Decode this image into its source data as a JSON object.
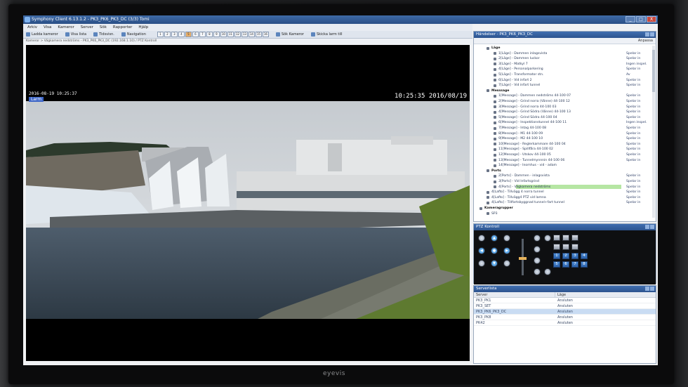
{
  "window": {
    "title": "Symphony Client 6.13.1.2 - PK3_PK6_PK3_DC (3/3) Tomi",
    "buttons": [
      "_",
      "□",
      "X"
    ]
  },
  "menu": [
    "Arkiv",
    "Visa",
    "Kameror",
    "Server",
    "Sök",
    "Rapporter",
    "Hjälp"
  ],
  "toolbar": {
    "items": [
      "Ladda kameror",
      "Visa lista",
      "Tidsvisn.",
      "Navigation",
      "Sök Kameror",
      "Skicka larm till"
    ],
    "layouts": [
      "1",
      "2",
      "3",
      "4",
      "5",
      "6",
      "7",
      "8",
      "9",
      "10",
      "11",
      "12",
      "13",
      "14",
      "15",
      "16"
    ]
  },
  "path": "Kameror > Vägkamera nedströms - PK3_PK6_PK3_DC (192.168.1.10) / PTZ Kontroll",
  "video": {
    "osd_date": "2016-08-19 10:25:37",
    "osd_badge": "Larm",
    "osd_time": "10:25:35 2016/08/19"
  },
  "events_panel": {
    "title": "Händelser - PK3_PK6_PK3_DC",
    "subbar_button": "Anpassa",
    "rows": [
      {
        "label": "Läge",
        "status": "",
        "depth": 1,
        "group": true
      },
      {
        "label": "1[Läge] - Dammen inlagsvista",
        "status": "Spelar in",
        "depth": 2
      },
      {
        "label": "2[Läge] - Dammen luckor",
        "status": "Spelar in",
        "depth": 2
      },
      {
        "label": "3[Läge] - Matkyl 7",
        "status": "Ingen inspel.",
        "depth": 2
      },
      {
        "label": "4[Läge] - Personalparkering",
        "status": "Spelar in",
        "depth": 2
      },
      {
        "label": "5[Läge] - Transformator stn.",
        "status": "Av",
        "depth": 2
      },
      {
        "label": "6[Läge] - Vid infart 2",
        "status": "Spelar in",
        "depth": 2
      },
      {
        "label": "7[Läge] - Vid infart tunnel",
        "status": "Spelar in",
        "depth": 2
      },
      {
        "label": "Messsage",
        "status": "",
        "depth": 1,
        "group": true
      },
      {
        "label": "1[Message] - Dammen nedströms 44-100 07",
        "status": "Spelar in",
        "depth": 2
      },
      {
        "label": "2[Message] - Grind norra (Vänne) 44-100 12",
        "status": "Spelar in",
        "depth": 2
      },
      {
        "label": "3[Message] - Grind norra 44-100 03",
        "status": "Spelar in",
        "depth": 2
      },
      {
        "label": "4[Message] - Grind Södra (Vänne) 44-100 13",
        "status": "Spelar in",
        "depth": 2
      },
      {
        "label": "5[Message] - Grind Södra 44-100 04",
        "status": "Spelar in",
        "depth": 2
      },
      {
        "label": "6[Message] - Inspektionstunnel 44-100 11",
        "status": "Ingen inspel.",
        "depth": 2
      },
      {
        "label": "7[Message] - Intag 44-100 08",
        "status": "Spelar in",
        "depth": 2
      },
      {
        "label": "8[Message] - M1 44-100 09",
        "status": "Spelar in",
        "depth": 2
      },
      {
        "label": "9[Message] - M2 44-100 10",
        "status": "Spelar in",
        "depth": 2
      },
      {
        "label": "10[Message] - Reglerkammare 44-100 04",
        "status": "Spelar in",
        "depth": 2
      },
      {
        "label": "11[Message] - Spillfåra 44-100 02",
        "status": "Spelar in",
        "depth": 2
      },
      {
        "label": "12[Message] - Utskov 44-100 05",
        "status": "Spelar in",
        "depth": 2
      },
      {
        "label": "13[Message] - Tunnelmynnnin 44-100 06",
        "status": "Spelar in",
        "depth": 2
      },
      {
        "label": "14[Message] - Inomhus - vid - adam",
        "status": "",
        "depth": 2
      },
      {
        "label": "Ports",
        "status": "",
        "depth": 1,
        "group": true
      },
      {
        "label": "2[Ports] - Dammen - inlagsvista",
        "status": "Spelar in",
        "depth": 2
      },
      {
        "label": "3[Ports] - Vid Infartsgrind",
        "status": "Spelar in",
        "depth": 2
      },
      {
        "label": "4[Ports] - Vägkamera nedströms",
        "status": "Spelar in",
        "depth": 2,
        "highlight": true
      },
      {
        "label": "4[Lafto] - Tillvägg 4 norra tunnel",
        "status": "Spelar in",
        "depth": 1
      },
      {
        "label": "4[Lafto] - Tillvägg4 PTZ vid lamna",
        "status": "Spelar in",
        "depth": 1
      },
      {
        "label": "4[Lafto] - Tillfartsbyggnad tunnel+fart tunnel",
        "status": "Spelar in",
        "depth": 1
      },
      {
        "label": "Kameragrupper",
        "status": "",
        "depth": 0,
        "group": true
      },
      {
        "label": "SP3",
        "status": "",
        "depth": 1
      }
    ]
  },
  "ptz_panel": {
    "title": "PTZ Kontroll",
    "numbers": [
      "1",
      "2",
      "3",
      "4",
      "5",
      "6",
      "7",
      "8"
    ],
    "zoom_level": 0.45
  },
  "server_panel": {
    "title": "Serverlista",
    "col_server": "Server",
    "col_state": "Läge",
    "rows": [
      {
        "server": "PK3_PK1",
        "state": "Ansluten"
      },
      {
        "server": "PK3_SET",
        "state": "Ansluten"
      },
      {
        "server": "PK3_PK6_PK3_DC",
        "state": "Ansluten",
        "selected": true
      },
      {
        "server": "PK3_PK8",
        "state": "Ansluten"
      },
      {
        "server": "PK42",
        "state": "Ansluten"
      }
    ]
  },
  "monitor_brand": "eyevis"
}
